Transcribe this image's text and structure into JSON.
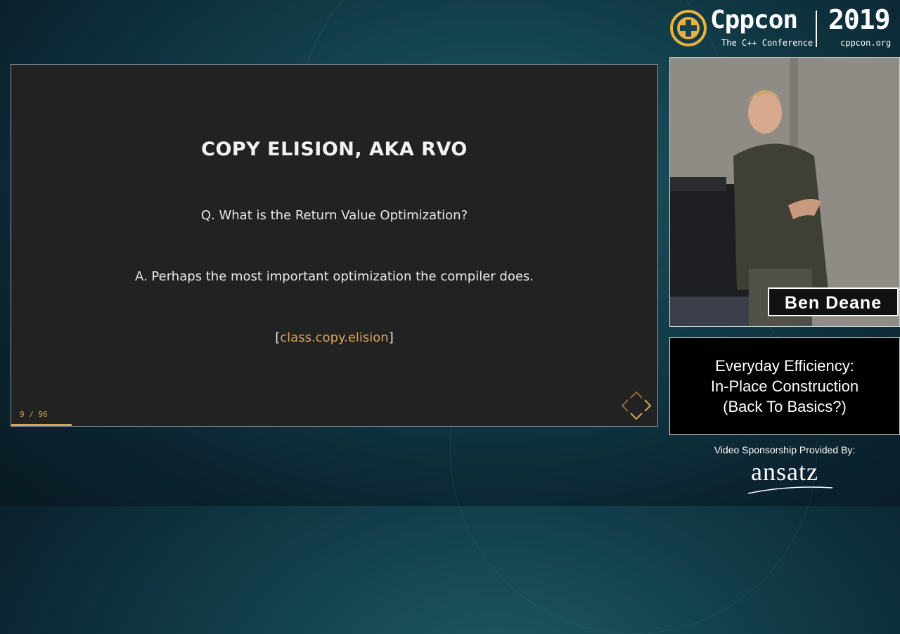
{
  "header": {
    "brand": "Cppcon",
    "tagline": "The C++ Conference",
    "year": "2019",
    "url": "cppcon.org"
  },
  "slide": {
    "title": "COPY ELISION, AKA RVO",
    "question": "Q. What is the Return Value Optimization?",
    "answer": "A. Perhaps the most important optimization the compiler does.",
    "ref_open": "[",
    "ref_link": "class.copy.elision",
    "ref_close": "]",
    "counter": "9 / 96",
    "progress": 0.0937
  },
  "speaker": {
    "name": "Ben Deane"
  },
  "talk": {
    "title_lines": [
      "Everyday Efficiency:",
      "In-Place Construction",
      "(Back To Basics?)"
    ]
  },
  "sponsor": {
    "caption": "Video Sponsorship Provided By:",
    "name": "ansatz"
  },
  "colors": {
    "accent": "#d6a55c",
    "slide_bg": "#222222"
  }
}
